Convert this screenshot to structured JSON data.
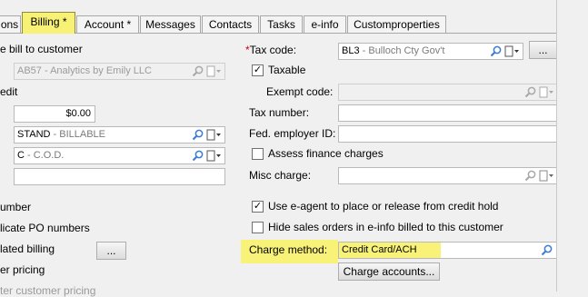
{
  "tabs": [
    {
      "label": "ons"
    },
    {
      "label": "Billing  *"
    },
    {
      "label": "Account *"
    },
    {
      "label": "Messages"
    },
    {
      "label": "Contacts"
    },
    {
      "label": "Tasks"
    },
    {
      "label": "e-info"
    },
    {
      "label": "Customproperties"
    }
  ],
  "left": {
    "bill_to_label": "e bill to customer",
    "bill_to_code": "AB57",
    "bill_to_desc": " - Analytics by Emily LLC",
    "credit_label": "edit",
    "credit_amount": "$0.00",
    "price_class_code": "STAND",
    "price_class_desc": " - BILLABLE",
    "terms_code": "C",
    "terms_desc": " - C.O.D.",
    "blank_field": "",
    "po_number_label": "umber",
    "duplicate_po_label": "licate PO numbers",
    "consolidated_label": "lated billing",
    "consolidated_button": "...",
    "pricing_label": "er pricing",
    "cut_label": "ter customer pricing"
  },
  "right": {
    "tax_code_required": "*",
    "tax_code_label": "Tax code:",
    "tax_code_code": "BL3",
    "tax_code_desc": " - Bulloch Cty Gov't",
    "tax_code_button": "...",
    "taxable_label": "Taxable",
    "taxable_checked": "✓",
    "exempt_code_label": "Exempt code:",
    "tax_number_label": "Tax number:",
    "fed_employer_label": "Fed. employer ID:",
    "assess_label": "Assess finance charges",
    "misc_charge_label": "Misc charge:",
    "use_eagent_label": "Use e-agent to place or release from credit hold",
    "use_eagent_checked": "✓",
    "hide_sales_label": "Hide sales orders in e-info billed to this customer",
    "charge_method_label": "Charge method:",
    "charge_method_value": "Credit Card/ACH",
    "charge_accounts_button": "Charge accounts..."
  },
  "colors": {
    "highlight": "#f8f279",
    "required": "#d00000"
  }
}
